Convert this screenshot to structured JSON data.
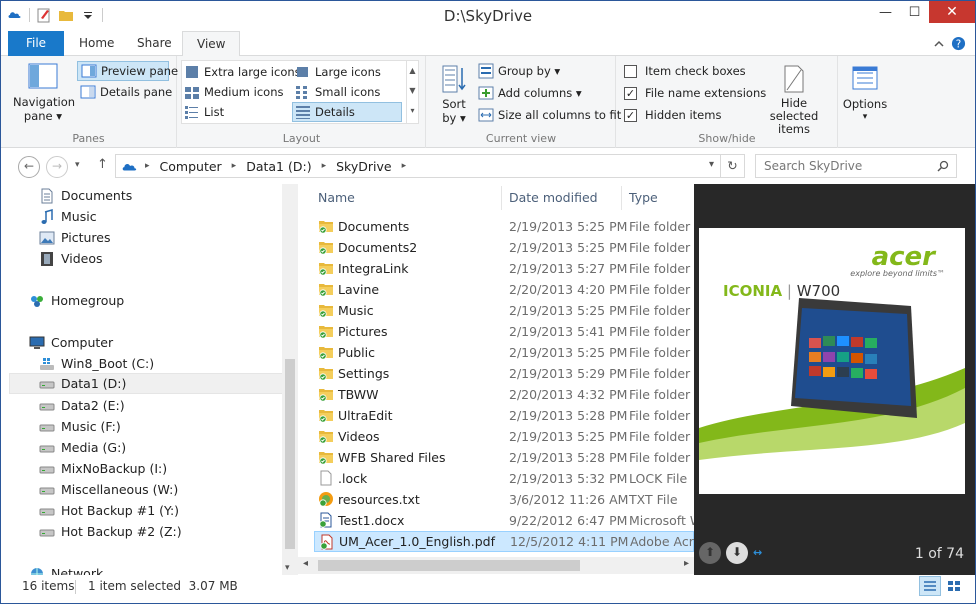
{
  "window": {
    "title": "D:\\SkyDrive",
    "buttons": {
      "minimize": "—",
      "maximize": "☐",
      "close": "✕"
    }
  },
  "ribbon_tabs": [
    "File",
    "Home",
    "Share",
    "View"
  ],
  "ribbon": {
    "panes": {
      "label": "Panes",
      "navigation_pane": "Navigation pane",
      "navigation_pane_l1": "Navigation",
      "navigation_pane_l2": "pane ▾",
      "preview_pane": "Preview pane",
      "details_pane": "Details pane"
    },
    "layout": {
      "label": "Layout",
      "extra_large_icons": "Extra large icons",
      "large_icons": "Large icons",
      "medium_icons": "Medium icons",
      "small_icons": "Small icons",
      "list": "List",
      "details": "Details"
    },
    "current_view": {
      "label": "Current view",
      "sort_by_l1": "Sort",
      "sort_by_l2": "by ▾",
      "group_by": "Group by ▾",
      "add_columns": "Add columns ▾",
      "size_all_columns": "Size all columns to fit"
    },
    "show_hide": {
      "label": "Show/hide",
      "item_check_boxes": "Item check boxes",
      "file_name_extensions": "File name extensions",
      "hidden_items": "Hidden items",
      "item_check_boxes_checked": false,
      "file_name_extensions_checked": true,
      "hidden_items_checked": true,
      "hide_selected_items_l1": "Hide selected",
      "hide_selected_items_l2": "items"
    },
    "options": {
      "label_l1": "Options",
      "label_l2": "▾"
    }
  },
  "address": {
    "crumbs": [
      "Computer",
      "Data1 (D:)",
      "SkyDrive"
    ],
    "search_placeholder": "Search SkyDrive"
  },
  "nav": {
    "favorites": [
      "Documents",
      "Music",
      "Pictures",
      "Videos"
    ],
    "homegroup": "Homegroup",
    "computer": "Computer",
    "drives": [
      "Win8_Boot (C:)",
      "Data1 (D:)",
      "Data2 (E:)",
      "Music (F:)",
      "Media (G:)",
      "MixNoBackup (I:)",
      "Miscellaneous (W:)",
      "Hot Backup #1 (Y:)",
      "Hot Backup #2 (Z:)"
    ],
    "network": "Network"
  },
  "columns": {
    "name": "Name",
    "date": "Date modified",
    "type": "Type"
  },
  "files": [
    {
      "name": "Documents",
      "date": "2/19/2013 5:25 PM",
      "type": "File folder",
      "icon": "folder"
    },
    {
      "name": "Documents2",
      "date": "2/19/2013 5:25 PM",
      "type": "File folder",
      "icon": "folder"
    },
    {
      "name": "IntegraLink",
      "date": "2/19/2013 5:27 PM",
      "type": "File folder",
      "icon": "folder"
    },
    {
      "name": "Lavine",
      "date": "2/20/2013 4:20 PM",
      "type": "File folder",
      "icon": "folder"
    },
    {
      "name": "Music",
      "date": "2/19/2013 5:25 PM",
      "type": "File folder",
      "icon": "folder"
    },
    {
      "name": "Pictures",
      "date": "2/19/2013 5:41 PM",
      "type": "File folder",
      "icon": "folder"
    },
    {
      "name": "Public",
      "date": "2/19/2013 5:25 PM",
      "type": "File folder",
      "icon": "folder"
    },
    {
      "name": "Settings",
      "date": "2/19/2013 5:29 PM",
      "type": "File folder",
      "icon": "folder"
    },
    {
      "name": "TBWW",
      "date": "2/20/2013 4:32 PM",
      "type": "File folder",
      "icon": "folder"
    },
    {
      "name": "UltraEdit",
      "date": "2/19/2013 5:28 PM",
      "type": "File folder",
      "icon": "folder"
    },
    {
      "name": "Videos",
      "date": "2/19/2013 5:25 PM",
      "type": "File folder",
      "icon": "folder"
    },
    {
      "name": "WFB Shared Files",
      "date": "2/19/2013 5:28 PM",
      "type": "File folder",
      "icon": "folder"
    },
    {
      "name": ".lock",
      "date": "2/19/2013 5:32 PM",
      "type": "LOCK File",
      "icon": "file"
    },
    {
      "name": "resources.txt",
      "date": "3/6/2012 11:26 AM",
      "type": "TXT File",
      "icon": "txt"
    },
    {
      "name": "Test1.docx",
      "date": "9/22/2012 6:47 PM",
      "type": "Microsoft W",
      "icon": "docx"
    },
    {
      "name": "UM_Acer_1.0_English.pdf",
      "date": "12/5/2012 4:11 PM",
      "type": "Adobe Acro",
      "icon": "pdf"
    }
  ],
  "preview": {
    "brand": "acer",
    "tagline": "explore beyond limits™",
    "product_a": "ICONIA",
    "product_b": "W700",
    "page_indicator": "1 of 74"
  },
  "status": {
    "items": "16 items",
    "selected": "1 item selected  3.07 MB"
  },
  "colors": {
    "accent": "#1979ca",
    "selection": "#cce8ff",
    "acer_green": "#83b81a",
    "preview_bg": "#282828"
  }
}
